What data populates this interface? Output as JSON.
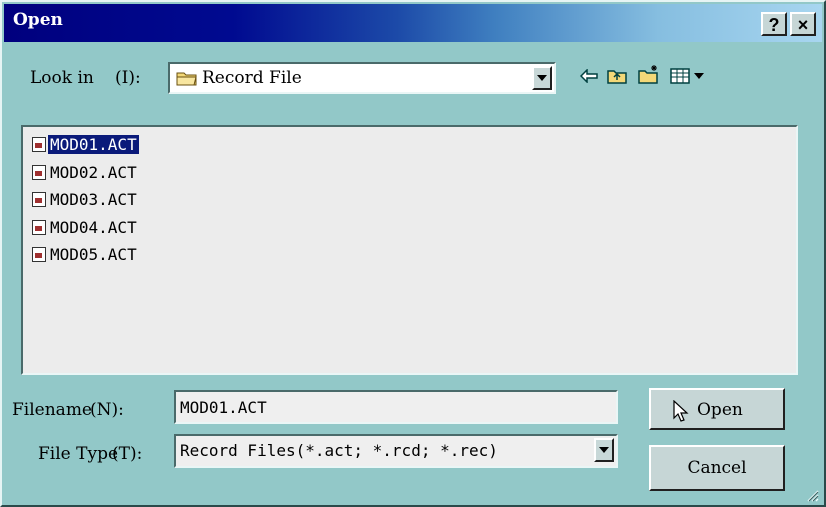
{
  "window": {
    "title": "Open",
    "help_label": "?",
    "close_label": "×"
  },
  "look_in": {
    "label": "Look in",
    "accel": "(I):",
    "value": "Record File"
  },
  "toolbar": {
    "icons": [
      "back-arrow-icon",
      "up-folder-icon",
      "new-folder-icon",
      "view-menu-icon"
    ]
  },
  "files": [
    {
      "name": "MOD01.ACT",
      "selected": true
    },
    {
      "name": "MOD02.ACT",
      "selected": false
    },
    {
      "name": "MOD03.ACT",
      "selected": false
    },
    {
      "name": "MOD04.ACT",
      "selected": false
    },
    {
      "name": "MOD05.ACT",
      "selected": false
    }
  ],
  "filename": {
    "label": "Filename",
    "accel": "(N):",
    "value": "MOD01.ACT"
  },
  "filetype": {
    "label": "File Type",
    "accel": "(T):",
    "value": "Record Files(*.act; *.rcd; *.rec)"
  },
  "buttons": {
    "open_label": "Open",
    "cancel_label": "Cancel"
  },
  "colors": {
    "dialog_bg": "#92c8c8",
    "title_start": "#00007e",
    "selection": "#0a1a7a"
  }
}
